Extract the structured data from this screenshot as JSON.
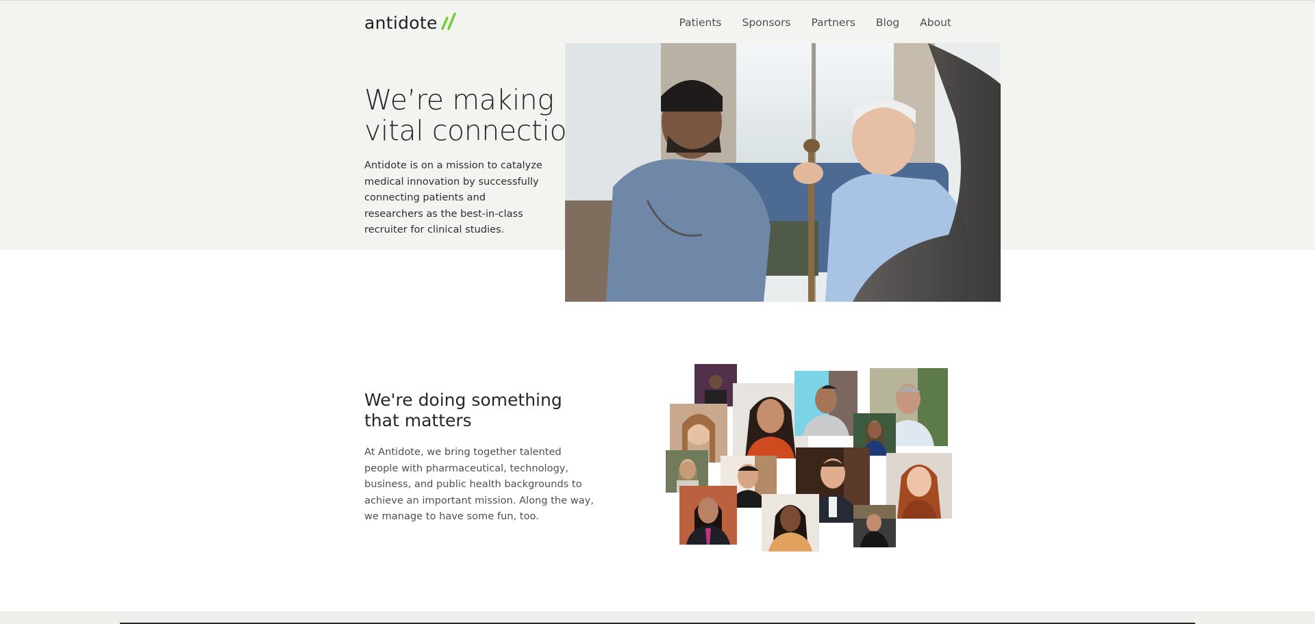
{
  "header": {
    "logo_text": "antidote",
    "logo_accent": "#6bd02f",
    "nav": [
      "Patients",
      "Sponsors",
      "Partners",
      "Blog",
      "About"
    ]
  },
  "hero": {
    "title": "We’re making vital connections",
    "body": "Antidote is on a mission to catalyze medical innovation by successfully connecting patients and researchers as the best-in-class recruiter for clinical studies."
  },
  "section2": {
    "title": "We're doing something that matters",
    "body": "At Antidote, we bring together talented people with pharmaceutical, technology, business, and public health backgrounds to achieve an important mission. Along the way, we manage to have some fun, too."
  },
  "colors": {
    "band": "#f3f3ef",
    "text": "#1f2224",
    "muted": "#4b5054"
  }
}
